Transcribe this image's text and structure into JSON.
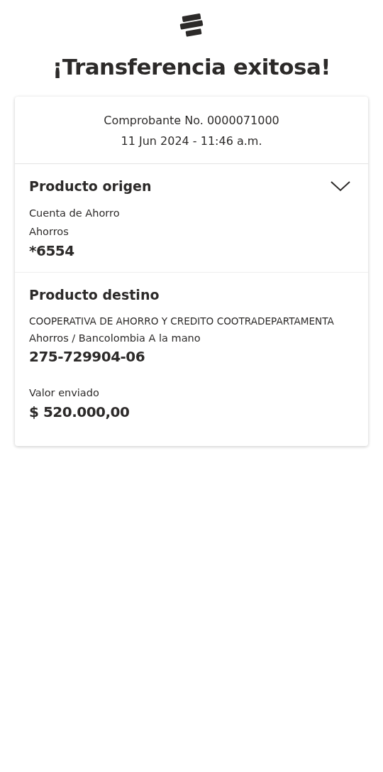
{
  "title": "¡Transferencia exitosa!",
  "receipt": {
    "number": "Comprobante No. 0000071000",
    "datetime": "11 Jun 2024 - 11:46 a.m."
  },
  "origin": {
    "heading": "Producto origen",
    "lines": [
      "Cuenta de Ahorro",
      "Ahorros"
    ],
    "account": "*6554"
  },
  "destination": {
    "heading": "Producto destino",
    "lines": [
      "COOPERATIVA DE AHORRO Y CREDITO COOTRADEPARTAMENTA",
      "Ahorros / Bancolombia A la mano"
    ],
    "account": "275-729904-06",
    "amount_label": "Valor enviado",
    "amount": "$ 520.000,00"
  }
}
